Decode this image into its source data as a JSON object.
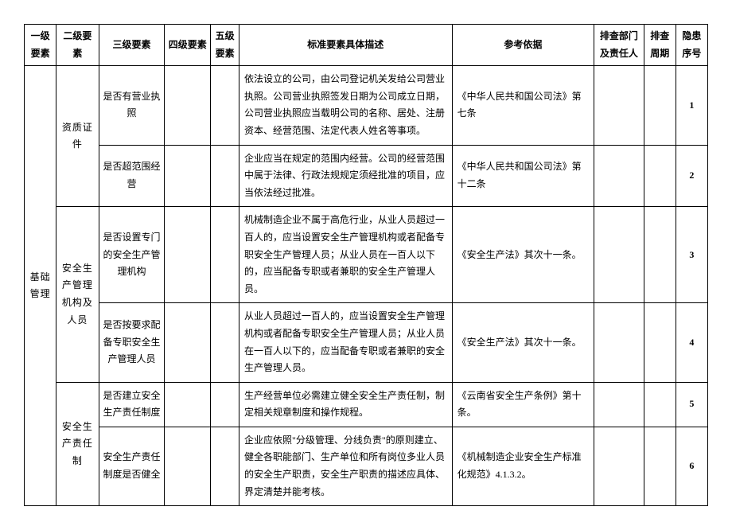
{
  "headers": {
    "l1": "一级要素",
    "l2": "二级要素",
    "l3": "三级要素",
    "l4": "四级要素",
    "l5": "五级要素",
    "desc": "标准要素具体描述",
    "ref": "参考依据",
    "dept": "排查部门及责任人",
    "cycle": "排查周期",
    "seq": "隐患序号"
  },
  "l1": "基础管理",
  "groups": [
    {
      "l2": "资质证件",
      "rows": [
        {
          "l3": "是否有营业执照",
          "l4": "",
          "l5": "",
          "desc": "依法设立的公司，由公司登记机关发给公司营业执照。公司营业执照签发日期为公司成立日期，公司营业执照应当载明公司的名称、居处、注册资本、经营范围、法定代表人姓名等事项。",
          "ref": "《中华人民共和国公司法》第七条",
          "dept": "",
          "cycle": "",
          "seq": "1"
        },
        {
          "l3": "是否超范围经营",
          "l4": "",
          "l5": "",
          "desc": "企业应当在规定的范围内经营。公司的经营范围中属于法律、行政法规规定须经批准的项目，应当依法经过批准。",
          "ref": "《中华人民共和国公司法》第十二条",
          "dept": "",
          "cycle": "",
          "seq": "2"
        }
      ]
    },
    {
      "l2": "安全生产管理机构及人员",
      "rows": [
        {
          "l3": "是否设置专门的安全生产管理机构",
          "l4": "",
          "l5": "",
          "desc": "机械制造企业不属于高危行业，从业人员超过一百人的，应当设置安全生产管理机构或者配备专职安全生产管理人员；从业人员在一百人以下的，应当配备专职或者兼职的安全生产管理人员。",
          "ref": "《安全生产法》其次十一条。",
          "dept": "",
          "cycle": "",
          "seq": "3"
        },
        {
          "l3": "是否按要求配备专职安全生产管理人员",
          "l4": "",
          "l5": "",
          "desc": "从业人员超过一百人的，应当设置安全生产管理机构或者配备专职安全生产管理人员；从业人员在一百人以下的，应当配备专职或者兼职的安全生产管理人员。",
          "ref": "《安全生产法》其次十一条。",
          "dept": "",
          "cycle": "",
          "seq": "4"
        }
      ]
    },
    {
      "l2": "安全生产责任制",
      "rows": [
        {
          "l3": "是否建立安全生产责任制度",
          "l4": "",
          "l5": "",
          "desc": "生产经营单位必需建立健全安全生产责任制，制定相关规章制度和操作规程。",
          "ref": "《云南省安全生产条例》第十条。",
          "dept": "",
          "cycle": "",
          "seq": "5"
        },
        {
          "l3": "安全生产责任制度是否健全",
          "l4": "",
          "l5": "",
          "desc": "企业应依照\"分级管理、分线负责\"的原则建立、健全各职能部门、生产单位和所有岗位多业人员的安全生产职责，安全生产职责的描述应具体、界定清楚并能考核。",
          "ref": "《机械制造企业安全生产标准化规范》4.1.3.2。",
          "dept": "",
          "cycle": "",
          "seq": "6"
        }
      ]
    }
  ]
}
